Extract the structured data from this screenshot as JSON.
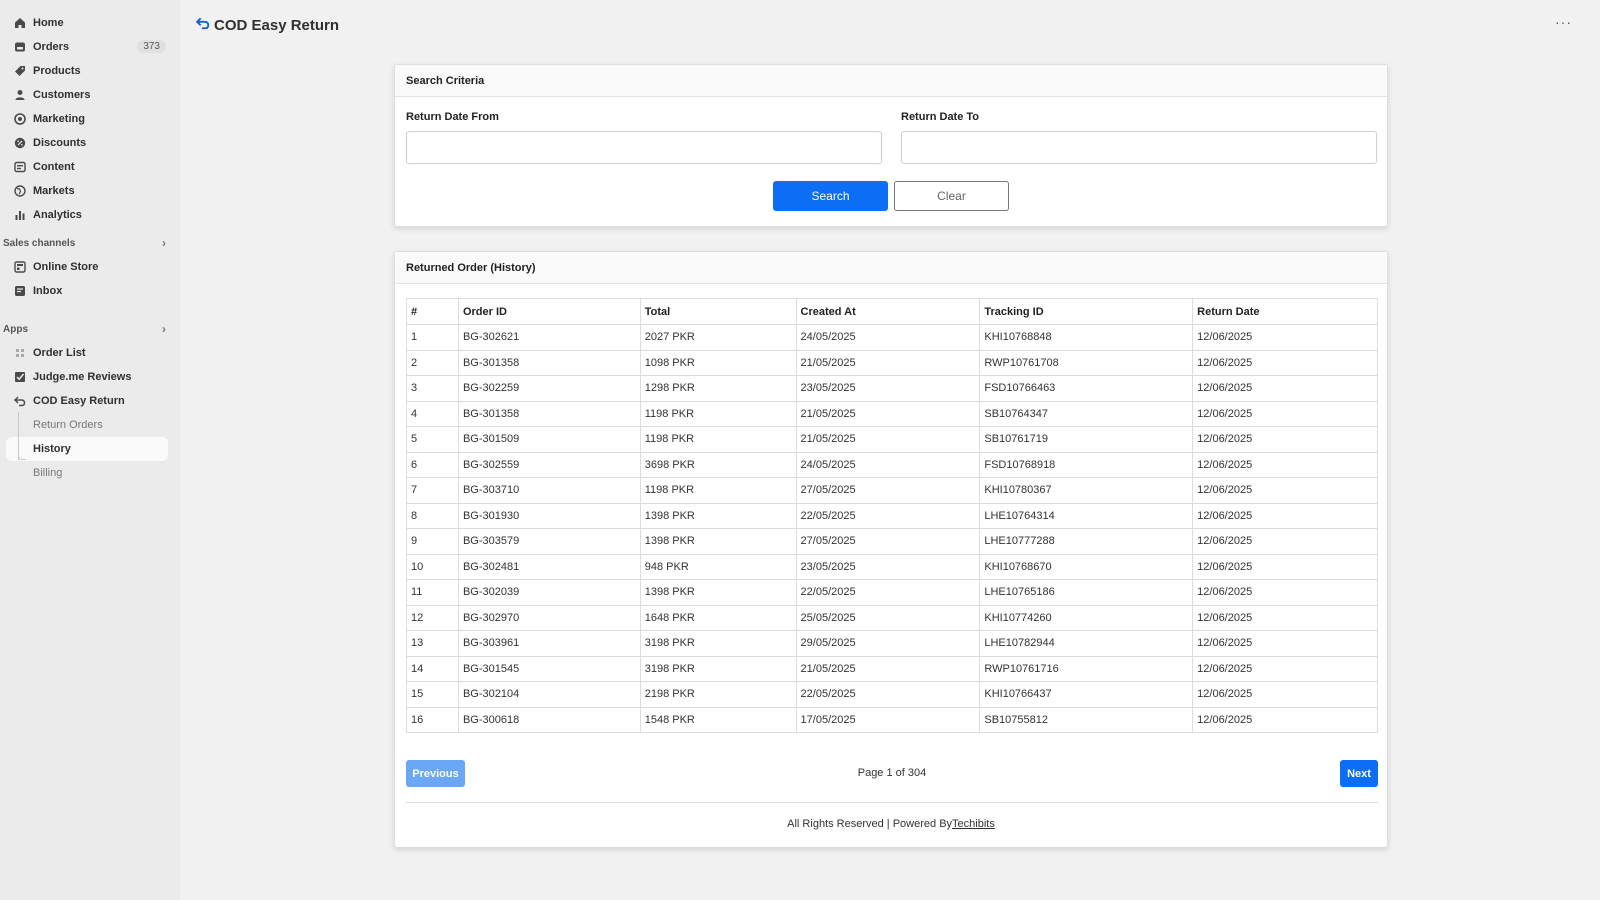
{
  "app": {
    "title": "COD Easy Return"
  },
  "sidebar": {
    "main": [
      {
        "label": "Home",
        "icon": "home-icon"
      },
      {
        "label": "Orders",
        "icon": "orders-icon",
        "badge": "373"
      },
      {
        "label": "Products",
        "icon": "tag-icon"
      },
      {
        "label": "Customers",
        "icon": "person-icon"
      },
      {
        "label": "Marketing",
        "icon": "target-icon"
      },
      {
        "label": "Discounts",
        "icon": "discount-icon"
      },
      {
        "label": "Content",
        "icon": "content-icon"
      },
      {
        "label": "Markets",
        "icon": "globe-icon"
      },
      {
        "label": "Analytics",
        "icon": "bar-chart-icon"
      }
    ],
    "sales_channels": {
      "heading": "Sales channels",
      "items": [
        {
          "label": "Online Store",
          "icon": "store-icon"
        },
        {
          "label": "Inbox",
          "icon": "inbox-icon"
        }
      ]
    },
    "apps": {
      "heading": "Apps",
      "items": [
        {
          "label": "Order List",
          "icon": "grid-icon"
        },
        {
          "label": "Judge.me Reviews",
          "icon": "check-box-icon"
        },
        {
          "label": "COD Easy Return",
          "icon": "return-arrow-icon"
        }
      ],
      "sub_items": [
        {
          "label": "Return Orders"
        },
        {
          "label": "History"
        },
        {
          "label": "Billing"
        }
      ]
    }
  },
  "search": {
    "heading": "Search Criteria",
    "from_label": "Return Date From",
    "from_value": "",
    "to_label": "Return Date To",
    "to_value": "",
    "search_label": "Search",
    "clear_label": "Clear"
  },
  "history": {
    "heading": "Returned Order (History)",
    "columns": [
      "#",
      "Order ID",
      "Total",
      "Created At",
      "Tracking ID",
      "Return Date"
    ],
    "rows": [
      [
        "1",
        "BG-302621",
        "2027 PKR",
        "24/05/2025",
        "KHI10768848",
        "12/06/2025"
      ],
      [
        "2",
        "BG-301358",
        "1098 PKR",
        "21/05/2025",
        "RWP10761708",
        "12/06/2025"
      ],
      [
        "3",
        "BG-302259",
        "1298 PKR",
        "23/05/2025",
        "FSD10766463",
        "12/06/2025"
      ],
      [
        "4",
        "BG-301358",
        "1198 PKR",
        "21/05/2025",
        "SB10764347",
        "12/06/2025"
      ],
      [
        "5",
        "BG-301509",
        "1198 PKR",
        "21/05/2025",
        "SB10761719",
        "12/06/2025"
      ],
      [
        "6",
        "BG-302559",
        "3698 PKR",
        "24/05/2025",
        "FSD10768918",
        "12/06/2025"
      ],
      [
        "7",
        "BG-303710",
        "1198 PKR",
        "27/05/2025",
        "KHI10780367",
        "12/06/2025"
      ],
      [
        "8",
        "BG-301930",
        "1398 PKR",
        "22/05/2025",
        "LHE10764314",
        "12/06/2025"
      ],
      [
        "9",
        "BG-303579",
        "1398 PKR",
        "27/05/2025",
        "LHE10777288",
        "12/06/2025"
      ],
      [
        "10",
        "BG-302481",
        "948 PKR",
        "23/05/2025",
        "KHI10768670",
        "12/06/2025"
      ],
      [
        "11",
        "BG-302039",
        "1398 PKR",
        "22/05/2025",
        "LHE10765186",
        "12/06/2025"
      ],
      [
        "12",
        "BG-302970",
        "1648 PKR",
        "25/05/2025",
        "KHI10774260",
        "12/06/2025"
      ],
      [
        "13",
        "BG-303961",
        "3198 PKR",
        "29/05/2025",
        "LHE10782944",
        "12/06/2025"
      ],
      [
        "14",
        "BG-301545",
        "3198 PKR",
        "21/05/2025",
        "RWP10761716",
        "12/06/2025"
      ],
      [
        "15",
        "BG-302104",
        "2198 PKR",
        "22/05/2025",
        "KHI10766437",
        "12/06/2025"
      ],
      [
        "16",
        "BG-300618",
        "1548 PKR",
        "17/05/2025",
        "SB10755812",
        "12/06/2025"
      ]
    ],
    "prev_label": "Previous",
    "next_label": "Next",
    "page_info": "Page 1 of 304"
  },
  "footer": {
    "text": "All Rights Reserved | Powered By",
    "link": "Techibits"
  },
  "colors": {
    "primary": "#0b6ef5",
    "primary_disabled": "#6aa8f6",
    "sidebar_bg": "#ebebeb",
    "page_bg": "#f1f1f1"
  }
}
